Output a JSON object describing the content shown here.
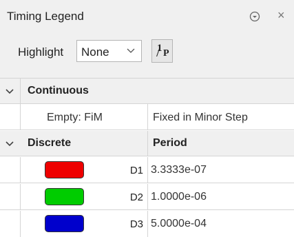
{
  "panel": {
    "title": "Timing Legend",
    "close_glyph": "×"
  },
  "highlight": {
    "label": "Highlight",
    "selected": "None"
  },
  "inverse_button": {
    "numerator": "1",
    "denominator": "P",
    "slash": "/"
  },
  "colors": {
    "red": "#ee0000",
    "green": "#00cc00",
    "blue": "#0000cc"
  },
  "table": {
    "continuous": {
      "label": "Continuous",
      "rows": [
        {
          "name": "Empty: FiM",
          "value": "Fixed in Minor Step"
        }
      ]
    },
    "discrete": {
      "label": "Discrete",
      "column_header": "Period",
      "rows": [
        {
          "color": "red",
          "signal": "D1",
          "period": "3.3333e-07"
        },
        {
          "color": "green",
          "signal": "D2",
          "period": "1.0000e-06"
        },
        {
          "color": "blue",
          "signal": "D3",
          "period": "5.0000e-04"
        }
      ]
    }
  }
}
